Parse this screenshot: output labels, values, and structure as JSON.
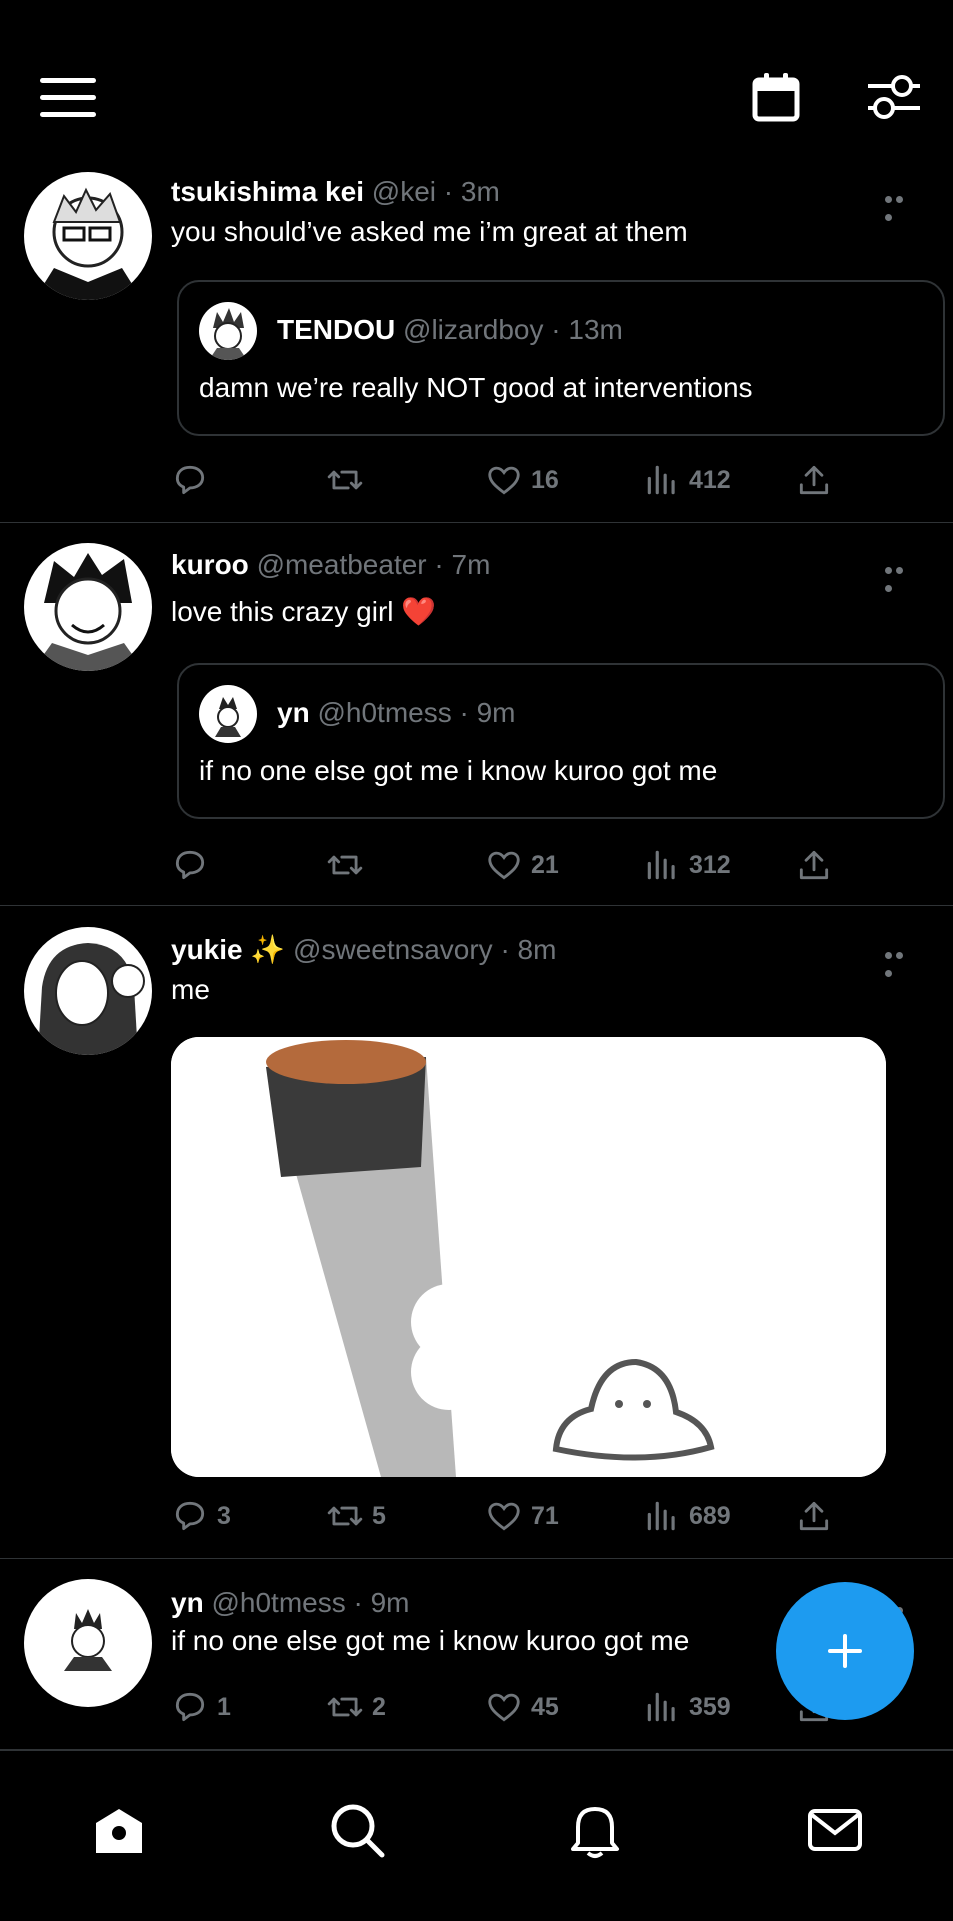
{
  "header": {
    "menu_icon": "hamburger-icon",
    "calendar_icon": "calendar-icon",
    "filter_icon": "sliders-icon"
  },
  "tweets": [
    {
      "name": "tsukishima kei",
      "handle": "@kei",
      "time": "· 3m",
      "text": "you should’ve asked me i’m great at them",
      "quote": {
        "name": "TENDOU",
        "handle": "@lizardboy",
        "time": "· 13m",
        "text": "damn we’re really NOT good at interventions"
      },
      "replies": "",
      "retweets": "",
      "likes": "16",
      "views": "412"
    },
    {
      "name": "kuroo",
      "handle": "@meatbeater",
      "time": "· 7m",
      "text": "love this crazy girl ❤️",
      "quote": {
        "name": "yn",
        "handle": "@h0tmess",
        "time": "· 9m",
        "text": "if no one else got me i know kuroo got me"
      },
      "replies": "",
      "retweets": "",
      "likes": "21",
      "views": "312"
    },
    {
      "name": "yukie",
      "name_badge": "✨",
      "handle": "@sweetnsavory",
      "time": "· 8m",
      "text": "me",
      "replies": "3",
      "retweets": "5",
      "likes": "71",
      "views": "689"
    },
    {
      "name": "yn",
      "handle": "@h0tmess",
      "time": "· 9m",
      "text": "if no one else got me i know kuroo got me",
      "replies": "1",
      "retweets": "2",
      "likes": "45",
      "views": "359"
    }
  ],
  "fab": {
    "icon": "plus-icon"
  },
  "bottom_nav": {
    "items": [
      "home-icon",
      "search-icon",
      "bell-icon",
      "mail-icon"
    ]
  },
  "colors": {
    "background": "#000000",
    "accent": "#1d9bf0",
    "muted": "#71767b",
    "divider": "#2f3336"
  }
}
